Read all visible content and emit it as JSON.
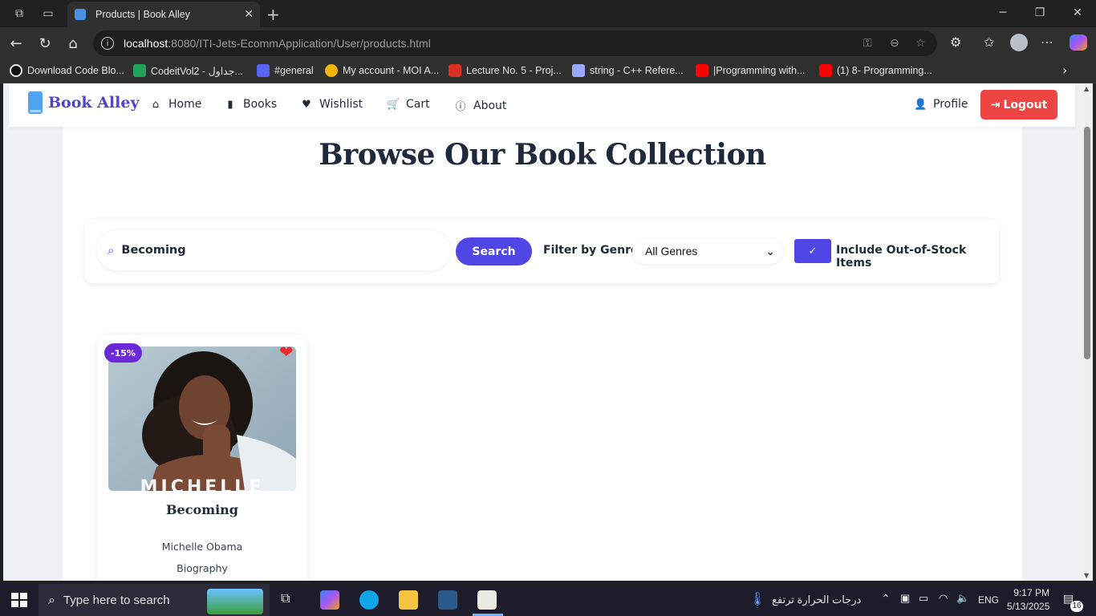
{
  "browser": {
    "tab_title": "Products | Book Alley",
    "url_host": "localhost",
    "url_rest": ":8080/ITI-Jets-EcommApplication/User/products.html"
  },
  "bookmarks": [
    {
      "label": "Download Code Blo...",
      "color": "#e8e8e8"
    },
    {
      "label": "CodeitVol2 - جداول...",
      "color": "#22a35a"
    },
    {
      "label": "#general",
      "color": "#5865f2"
    },
    {
      "label": "My account - MOI A...",
      "color": "#f5b400"
    },
    {
      "label": "Lecture No. 5 - Proj...",
      "color": "#d93025"
    },
    {
      "label": "string - C++ Refere...",
      "color": "#9aa6ff"
    },
    {
      "label": "|Programming with...",
      "color": "#ff0000"
    },
    {
      "label": "(1) 8- Programming...",
      "color": "#ff0000"
    }
  ],
  "site": {
    "logo": "Book Alley",
    "nav": {
      "home": "Home",
      "books": "Books",
      "wishlist": "Wishlist",
      "cart": "Cart",
      "about": "About",
      "profile": "Profile",
      "logout": "Logout"
    },
    "page_title": "Browse Our Book Collection"
  },
  "filters": {
    "search_value": "Becoming",
    "search_button": "Search",
    "genre_label": "Filter by Genre:",
    "genre_selected": "All Genres",
    "out_of_stock_label": "Include Out-of-Stock Items",
    "out_of_stock_checked": true
  },
  "products": [
    {
      "title": "Becoming",
      "author": "Michelle Obama",
      "genre": "Biography",
      "discount": "-15%",
      "cover_overlay_text": "MICHELLE",
      "wishlisted": true
    }
  ],
  "taskbar": {
    "search_placeholder": "Type here to search",
    "weather_text": "درجات الحرارة ترتفع",
    "language": "ENG",
    "time": "9:17 PM",
    "date": "5/13/2025",
    "notification_count": "16"
  },
  "colors": {
    "accent": "#4f46e5",
    "logout": "#ef4444",
    "badge": "#6d28d9"
  }
}
